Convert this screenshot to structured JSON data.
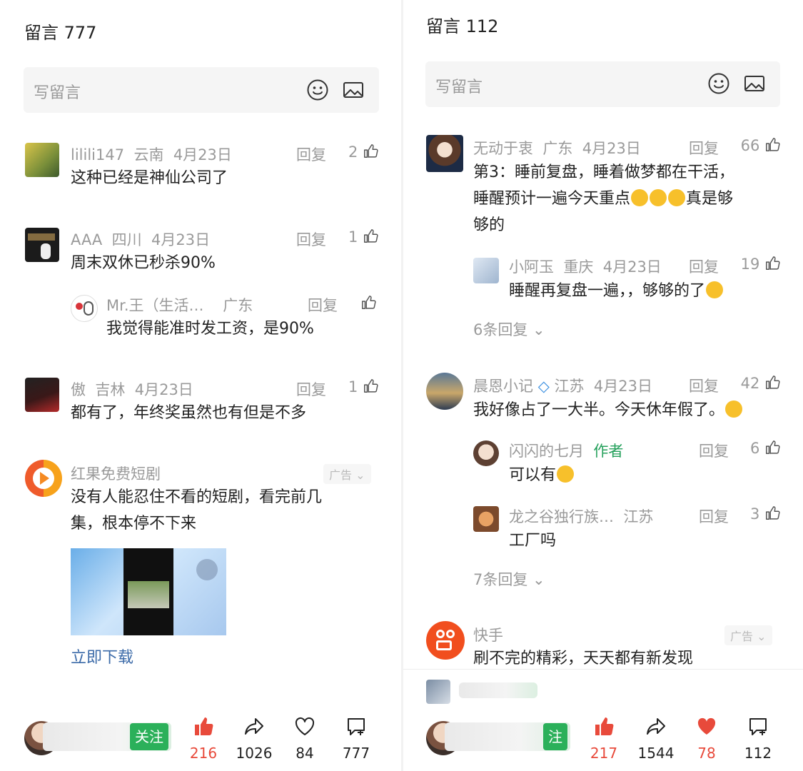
{
  "left": {
    "title": "留言 777",
    "input_placeholder": "写留言",
    "comments": [
      {
        "user": "lilili147",
        "loc": "云南",
        "date": "4月23日",
        "reply": "回复",
        "likes": "2",
        "text": "这种已经是神仙公司了"
      },
      {
        "user": "AAA",
        "loc": "四川",
        "date": "4月23日",
        "reply": "回复",
        "likes": "1",
        "text": "周末双休已秒杀90%"
      },
      {
        "user": "傲",
        "loc": "吉林",
        "date": "4月23日",
        "reply": "回复",
        "likes": "1",
        "text": "都有了，年终奖虽然也有但是不多"
      }
    ],
    "subreply": {
      "user": "Mr.王（生活…",
      "loc": "广东",
      "reply": "回复",
      "text": "我觉得能准时发工资，是90%"
    },
    "ad": {
      "name": "红果免费短剧",
      "tag": "广告",
      "text1": "没有人能忍住不看的短剧，看完前几",
      "text2": "集，根本停不下来",
      "link": "立即下载"
    },
    "bottom": {
      "follow": "关注",
      "likes": "216",
      "shares": "1026",
      "favs": "84",
      "comments": "777"
    }
  },
  "right": {
    "title": "留言 112",
    "input_placeholder": "写留言",
    "c1": {
      "user": "无动于衷",
      "loc": "广东",
      "date": "4月23日",
      "reply": "回复",
      "likes": "66",
      "line1": "第3：睡前复盘，睡着做梦都在干活，",
      "line2a": "睡醒预计一遍今天重点",
      "line2b": "真是够",
      "line3": "够的"
    },
    "r1": {
      "user": "小阿玉",
      "loc": "重庆",
      "date": "4月23日",
      "reply": "回复",
      "likes": "19",
      "text": "睡醒再复盘一遍，，够够的了"
    },
    "more1": "6条回复",
    "c2": {
      "user": "晨恩小记",
      "loc": "江苏",
      "date": "4月23日",
      "reply": "回复",
      "likes": "42",
      "text": "我好像占了一大半。今天休年假了。"
    },
    "r2": {
      "user": "闪闪的七月",
      "badge": "作者",
      "reply": "回复",
      "likes": "6",
      "text": "可以有"
    },
    "r3": {
      "user": "龙之谷独行族…",
      "loc": "江苏",
      "reply": "回复",
      "likes": "3",
      "text": "工厂吗"
    },
    "more2": "7条回复",
    "ad": {
      "name": "快手",
      "tag": "广告",
      "text": "刷不完的精彩，天天都有新发现"
    },
    "bottom": {
      "follow": "注",
      "likes": "217",
      "shares": "1544",
      "favs": "78",
      "comments": "112"
    }
  },
  "colors": {
    "like_red": "#e84a3b",
    "follow_green": "#2bb05a",
    "author_green": "#24a05b",
    "link_blue": "#3b6aa8"
  }
}
